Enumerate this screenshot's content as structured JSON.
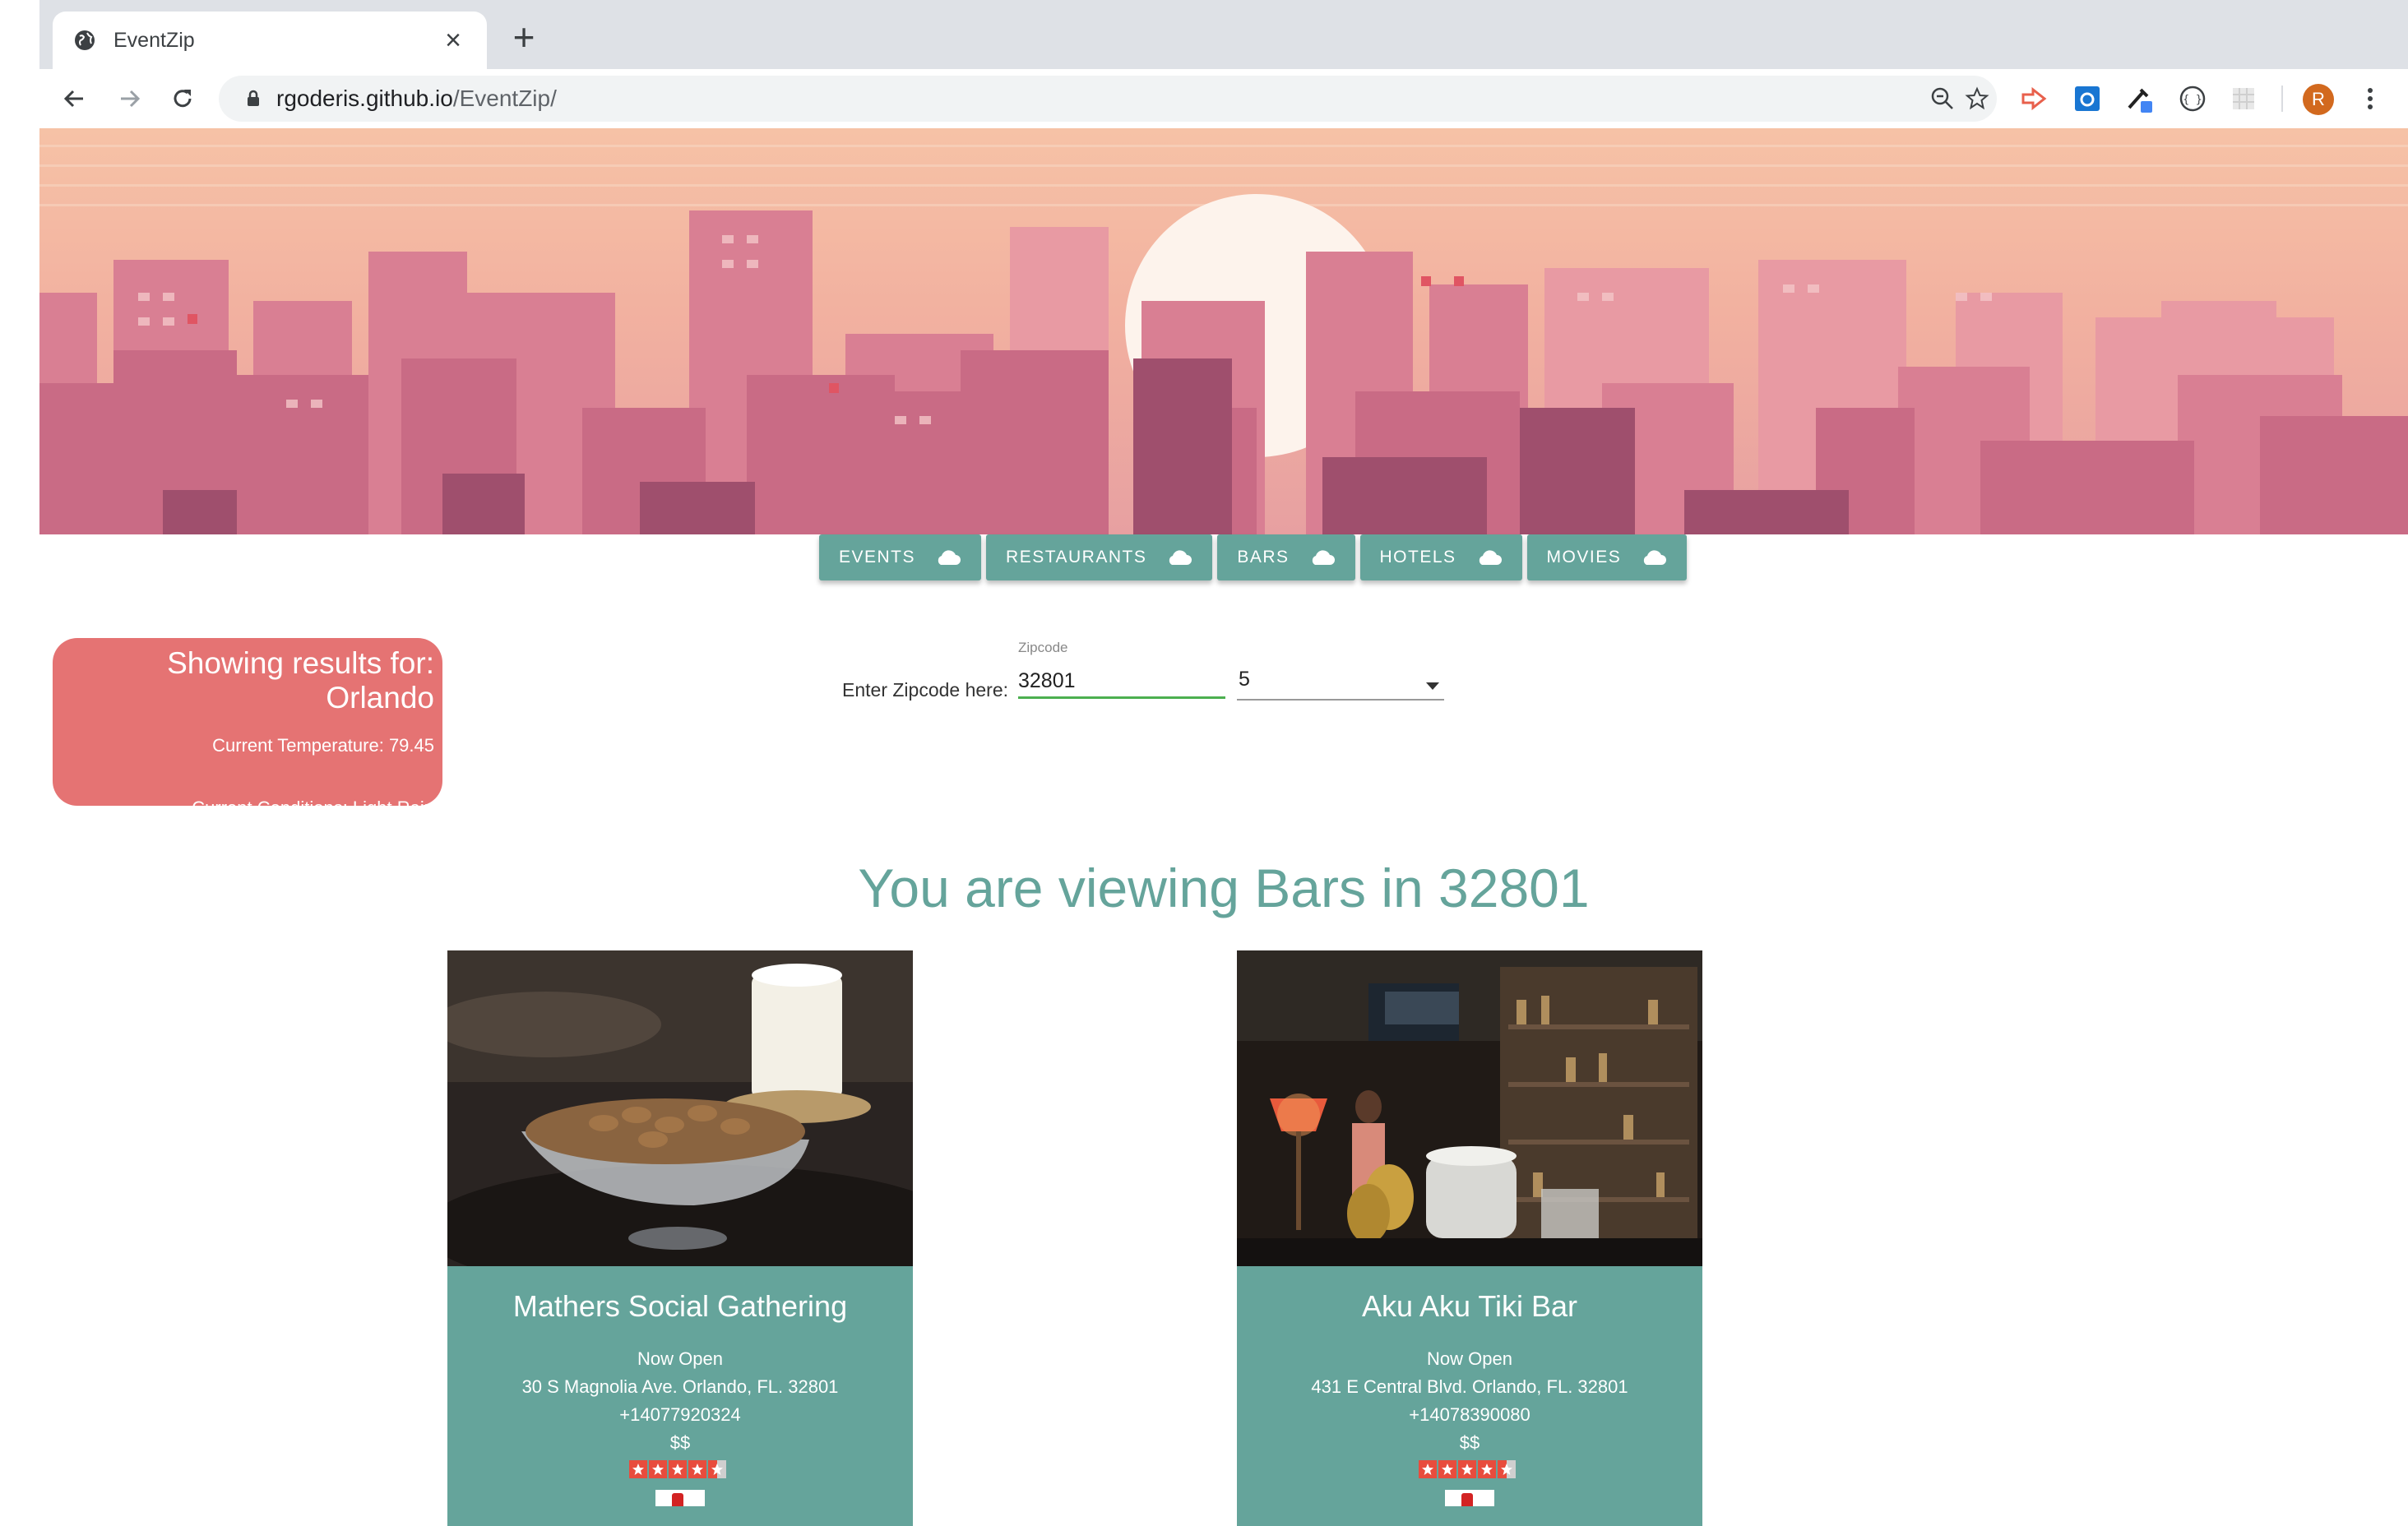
{
  "browser": {
    "tab_title": "EventZip",
    "url_host": "rgoderis.github.io",
    "url_path": "/EventZip/",
    "profile_initial": "R"
  },
  "icons": {
    "tab_favicon": "globe-icon",
    "back": "back-arrow-icon",
    "forward": "forward-arrow-icon",
    "reload": "reload-icon",
    "lock": "lock-icon",
    "zoom": "zoom-out-icon",
    "bookmark": "star-icon",
    "menu": "more-vert-icon",
    "nav_item": "cloud-icon"
  },
  "colors": {
    "accent": "#65a49b",
    "weather_card": "#e57373",
    "star": "#e84c3d"
  },
  "nav": {
    "items": [
      "EVENTS",
      "RESTAURANTS",
      "BARS",
      "HOTELS",
      "MOVIES"
    ]
  },
  "weather": {
    "title": "Showing results for: Orlando",
    "temperature": "Current Temperature: 79.45",
    "conditions": "Current Conditions: Light Rain"
  },
  "search": {
    "label": "Enter Zipcode here:",
    "floating_label": "Zipcode",
    "zipcode_value": "32801",
    "radius_value": "5"
  },
  "results": {
    "heading": "You are viewing Bars in 32801",
    "cards": [
      {
        "name": "Mathers Social Gathering",
        "status": "Now Open",
        "address": "30 S Magnolia Ave. Orlando, FL. 32801",
        "phone": "+14077920324",
        "price": "$$",
        "rating": 4.5
      },
      {
        "name": "Aku Aku Tiki Bar",
        "status": "Now Open",
        "address": "431 E Central Blvd. Orlando, FL. 32801",
        "phone": "+14078390080",
        "price": "$$",
        "rating": 4.5
      }
    ]
  }
}
